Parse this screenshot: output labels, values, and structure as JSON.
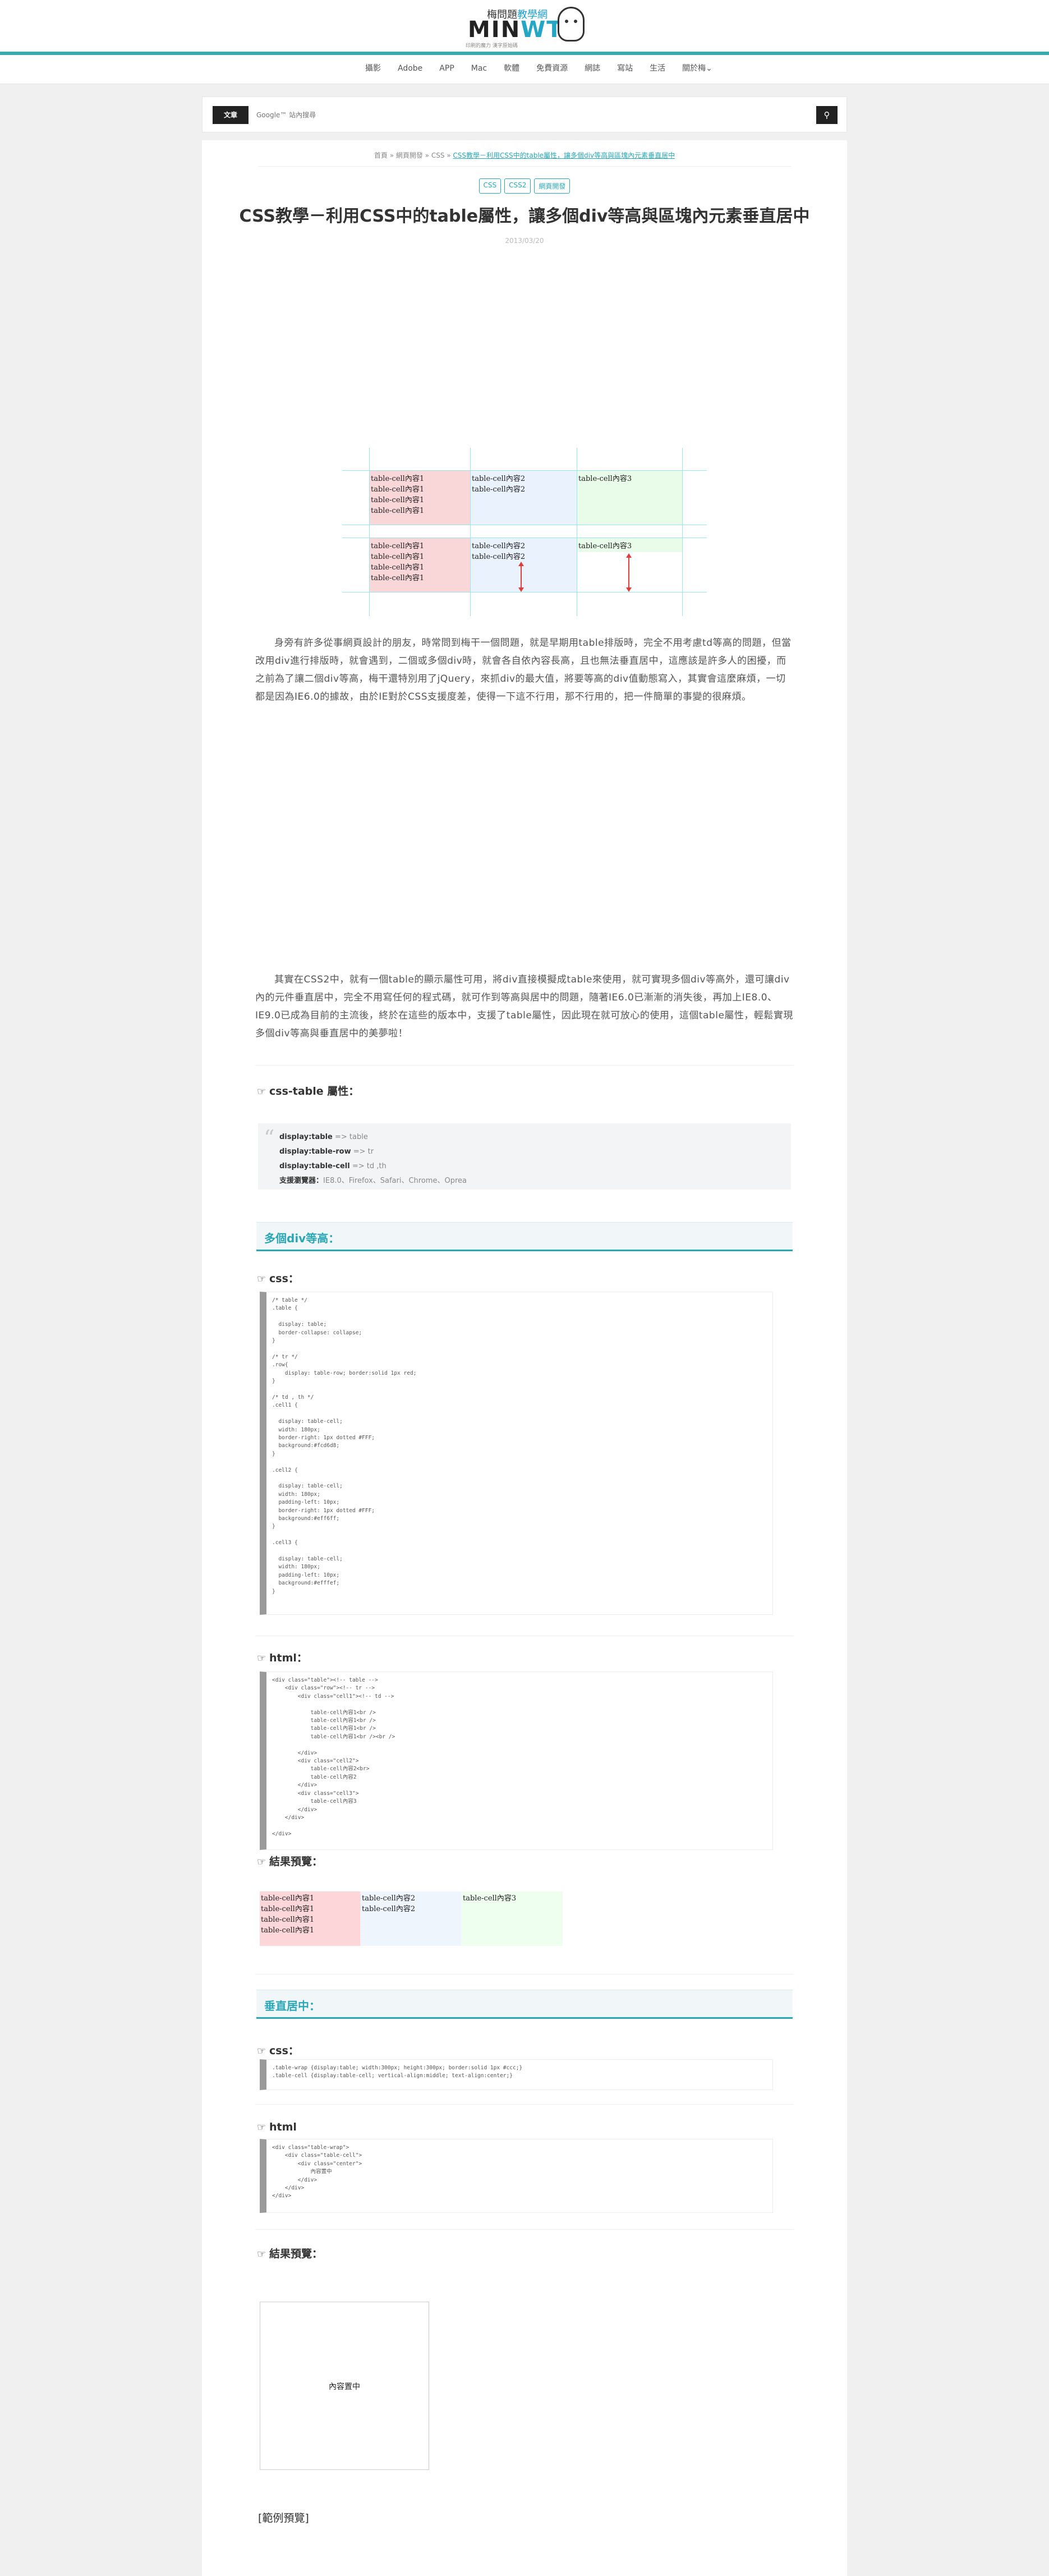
{
  "header": {
    "logo_top_prefix": "梅問題",
    "logo_top_highlight": "教學網",
    "logo_name_1": "MIN",
    "logo_name_2": "WT",
    "logo_sub": "印刷的魔力 漢字原始碼"
  },
  "nav": [
    "攝影",
    "Adobe",
    "APP",
    "Mac",
    "軟體",
    "免費資源",
    "網誌",
    "寫站",
    "生活",
    "關於梅⌄"
  ],
  "search": {
    "scope": "文章",
    "placeholder": "Google™ 站內搜尋",
    "button_icon": "search-icon"
  },
  "article": {
    "breadcrumb_prefix": "首頁 » 網頁開發 » CSS » ",
    "breadcrumb_current": "CSS教學－利用CSS中的table屬性，讓多個div等高與區塊內元素垂直居中",
    "tags": [
      "CSS",
      "CSS2",
      "網頁開發"
    ],
    "title": "CSS教學－利用CSS中的table屬性，讓多個div等高與區塊內元素垂直居中",
    "date": "2013/03/20",
    "para1": "身旁有許多從事網頁設計的朋友，時常問到梅干一個問題，就是早期用table排版時，完全不用考慮td等高的問題，但當改用div進行排版時，就會遇到，二個或多個div時，就會各自依內容長高，且也無法垂直居中，這應該是許多人的困擾，而之前為了讓二個div等高，梅干還特別用了jQuery，來抓div的最大值，將要等高的div值動態寫入，其實會這麼麻煩，一切都是因為IE6.0的據故，由於IE對於CSS支援度差，使得一下這不行用，那不行用的，把一件簡單的事變的很麻煩。",
    "para2": "其實在CSS2中，就有一個table的顯示屬性可用，將div直接模擬成table來使用，就可實現多個div等高外，還可讓div內的元件垂直居中，完全不用寫任何的程式碼，就可作到等高與居中的問題，隨著IE6.0已漸漸的消失後，再加上IE8.0、IE9.0已成為目前的主流後，終於在這些的版本中，支援了table屬性，因此現在就可放心的使用，這個table屬性，輕鬆實現多個div等高與垂直居中的美夢啦！",
    "css_table_heading": "css-table 屬性：",
    "quote": [
      {
        "key": "display:table",
        "val": " => table"
      },
      {
        "key": "display:table-row",
        "val": " => tr"
      },
      {
        "key": "display:table-cell",
        "val": " => td ,th"
      },
      {
        "key": "支援瀏覽器：",
        "val": "IE8.0、Firefox、Safari、Chrome、Oprea"
      }
    ],
    "section1_title": "多個div等高：",
    "css_label": "css：",
    "code_css1": "/* table */\n.table {\n\n  display: table;\n  border-collapse: collapse;\n}\n\n/* tr */\n.row{\n    display: table-row; border:solid 1px red;\n}\n\n/* td , th */\n.cell1 {\n\n  display: table-cell;\n  width: 180px;\n  border-right: 1px dotted #FFF;\n  background:#fcd6d8;\n}\n\n.cell2 {\n\n  display: table-cell;\n  width: 180px;\n  padding-left: 10px;\n  border-right: 1px dotted #FFF;\n  background:#eff6ff;\n}\n\n.cell3 {\n\n  display: table-cell;\n  width: 180px;\n  padding-left: 10px;\n  background:#efffef;\n}",
    "html_label": "html：",
    "code_html1": "<div class=\"table\"><!-- table -->\n    <div class=\"row\"><!-- tr -->\n        <div class=\"cell1\"><!-- td -->\n\n            table-cell內容1<br />\n            table-cell內容1<br />\n            table-cell內容1<br />\n            table-cell內容1<br /><br />\n\n        </div>\n        <div class=\"cell2\">\n            table-cell內容2<br>\n            table-cell內容2\n        </div>\n        <div class=\"cell3\">\n            table-cell內容3\n        </div>\n    </div>\n\n</div>",
    "result_label": "結果預覽：",
    "result_cells": [
      {
        "lines": [
          "table-cell內容1",
          "table-cell內容1",
          "table-cell內容1",
          "table-cell內容1"
        ]
      },
      {
        "lines": [
          "table-cell內容2",
          "table-cell內容2"
        ]
      },
      {
        "lines": [
          "table-cell內容3"
        ]
      }
    ],
    "section2_title": "垂直居中：",
    "css_label2": "css：",
    "code_css2": ".table-wrap {display:table; width:300px; height:300px; border:solid 1px #ccc;}\n.table-cell {display:table-cell; vertical-align:middle; text-align:center;}",
    "html_label2": "html",
    "code_html2": "<div class=\"table-wrap\">\n    <div class=\"table-cell\">\n        <div class=\"center\">\n            內容置中\n        </div>\n    </div>\n</div>",
    "result_label2": "結果預覽：",
    "center_text": "內容置中",
    "demo_link": "[範例預覽]"
  },
  "demo_image": {
    "row1": {
      "c1": [
        "table-cell內容1",
        "table-cell內容1",
        "table-cell內容1",
        "table-cell內容1"
      ],
      "c2": [
        "table-cell內容2",
        "table-cell內容2"
      ],
      "c3": [
        "table-cell內容3"
      ]
    },
    "row2": {
      "c1": [
        "table-cell內容1",
        "table-cell內容1",
        "table-cell內容1",
        "table-cell內容1"
      ],
      "c2": [
        "table-cell內容2",
        "table-cell內容2"
      ],
      "c3": [
        "table-cell內容3"
      ]
    }
  },
  "colors": {
    "accent": "#2aa7b7",
    "nav_line": "#3aa8b0",
    "cell_pink": "#fcd6d8",
    "cell_blue": "#eff6ff",
    "cell_green": "#efffef"
  }
}
